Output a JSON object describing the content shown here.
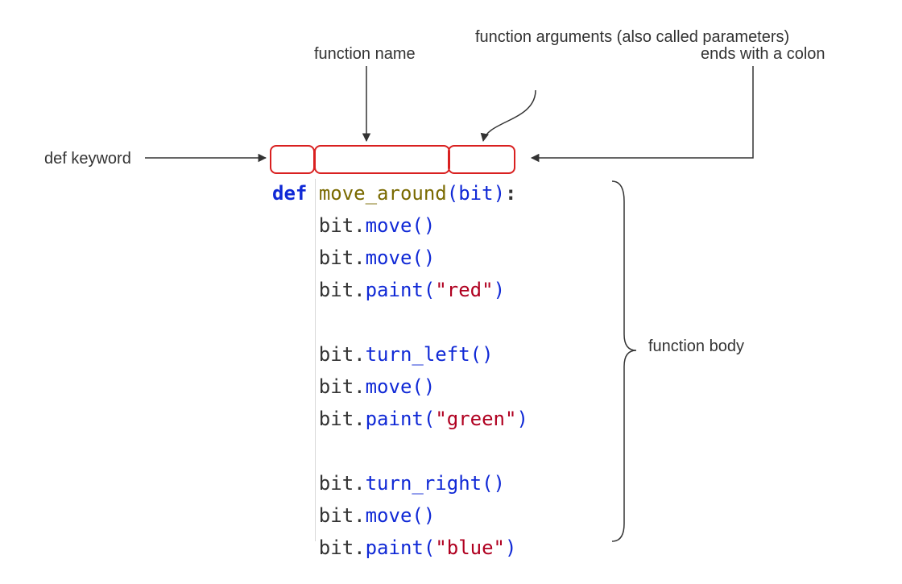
{
  "labels": {
    "def_keyword": "def keyword",
    "function_name": "function name",
    "arguments": "function arguments\n(also called\nparameters)",
    "colon": "ends with a colon",
    "body": "function\nbody"
  },
  "code": {
    "keyword": "def",
    "name": "move_around",
    "param": "bit",
    "lines": [
      {
        "obj": "bit",
        "method": "move",
        "arg": null
      },
      {
        "obj": "bit",
        "method": "move",
        "arg": null
      },
      {
        "obj": "bit",
        "method": "paint",
        "arg": "\"red\""
      },
      {
        "blank": true
      },
      {
        "obj": "bit",
        "method": "turn_left",
        "arg": null
      },
      {
        "obj": "bit",
        "method": "move",
        "arg": null
      },
      {
        "obj": "bit",
        "method": "paint",
        "arg": "\"green\""
      },
      {
        "blank": true
      },
      {
        "obj": "bit",
        "method": "turn_right",
        "arg": null
      },
      {
        "obj": "bit",
        "method": "move",
        "arg": null
      },
      {
        "obj": "bit",
        "method": "paint",
        "arg": "\"blue\""
      }
    ]
  }
}
